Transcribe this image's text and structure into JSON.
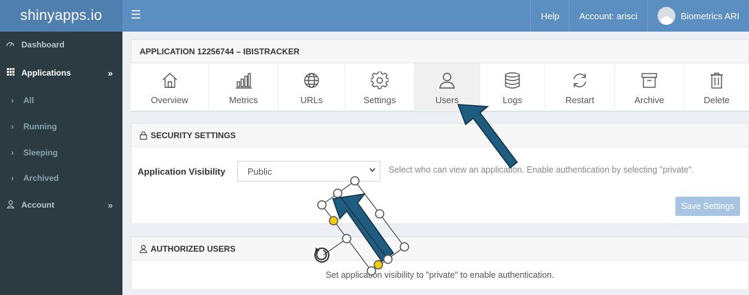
{
  "brand": "shinyapps.io",
  "topnav": {
    "menu_icon": "hamburger-icon",
    "help": "Help",
    "account": "Account: arisci",
    "user": "Biometrics ARI"
  },
  "sidebar": {
    "dashboard": "Dashboard",
    "applications": "Applications",
    "all": "All",
    "running": "Running",
    "sleeping": "Sleeping",
    "archived": "Archived",
    "account": "Account",
    "chevron": "»",
    "caret": "›"
  },
  "app_header": "APPLICATION 12256744 – IBISTRACKER",
  "tabs": [
    {
      "label": "Overview",
      "icon": "home-icon"
    },
    {
      "label": "Metrics",
      "icon": "bar-chart-icon"
    },
    {
      "label": "URLs",
      "icon": "globe-icon"
    },
    {
      "label": "Settings",
      "icon": "gear-icon"
    },
    {
      "label": "Users",
      "icon": "user-icon"
    },
    {
      "label": "Logs",
      "icon": "database-icon"
    },
    {
      "label": "Restart",
      "icon": "refresh-icon"
    },
    {
      "label": "Archive",
      "icon": "archive-icon"
    },
    {
      "label": "Delete",
      "icon": "trash-icon"
    }
  ],
  "security": {
    "title": "SECURITY SETTINGS",
    "visibility_label": "Application Visibility",
    "visibility_value": "Public",
    "help_text": "Select who can view an application. Enable authentication by selecting \"private\".",
    "save_button": "Save Settings"
  },
  "authorized": {
    "title": "AUTHORIZED USERS",
    "message": "Set application visibility to \"private\" to enable authentication."
  },
  "colors": {
    "topbar": "#5b8ec1",
    "sidebar": "#2c3b41",
    "arrow": "#1f5d80",
    "handle_yellow": "#f5d000"
  }
}
